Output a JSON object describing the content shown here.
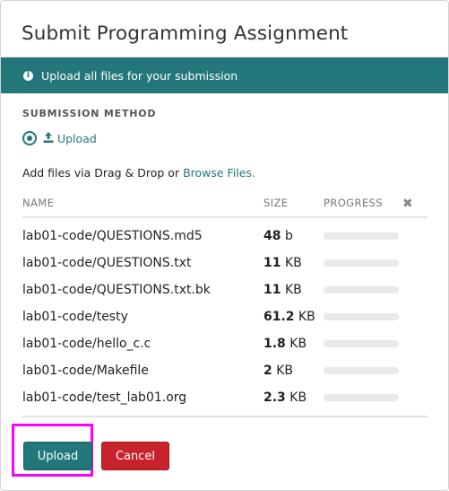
{
  "dialog": {
    "title": "Submit Programming Assignment"
  },
  "banner": {
    "icon": "info-icon",
    "text": "Upload all files for your submission",
    "color": "#23777a"
  },
  "submission_method": {
    "label": "SUBMISSION METHOD",
    "option_label": "Upload",
    "selected": true
  },
  "add_files": {
    "prefix": "Add files via Drag & Drop or ",
    "link_label": "Browse Files."
  },
  "table": {
    "headers": {
      "name": "NAME",
      "size": "SIZE",
      "progress": "PROGRESS",
      "clear_icon": "close-icon"
    },
    "rows": [
      {
        "name": "lab01-code/QUESTIONS.md5",
        "size_value": "48",
        "size_unit": "b",
        "progress": 0
      },
      {
        "name": "lab01-code/QUESTIONS.txt",
        "size_value": "11",
        "size_unit": "KB",
        "progress": 0
      },
      {
        "name": "lab01-code/QUESTIONS.txt.bk",
        "size_value": "11",
        "size_unit": "KB",
        "progress": 0
      },
      {
        "name": "lab01-code/testy",
        "size_value": "61.2",
        "size_unit": "KB",
        "progress": 0
      },
      {
        "name": "lab01-code/hello_c.c",
        "size_value": "1.8",
        "size_unit": "KB",
        "progress": 0
      },
      {
        "name": "lab01-code/Makefile",
        "size_value": "2",
        "size_unit": "KB",
        "progress": 0
      },
      {
        "name": "lab01-code/test_lab01.org",
        "size_value": "2.3",
        "size_unit": "KB",
        "progress": 0
      }
    ]
  },
  "footer": {
    "upload_label": "Upload",
    "cancel_label": "Cancel",
    "upload_color": "#23777a",
    "cancel_color": "#c8232c",
    "highlight_color": "#ff00ff"
  }
}
